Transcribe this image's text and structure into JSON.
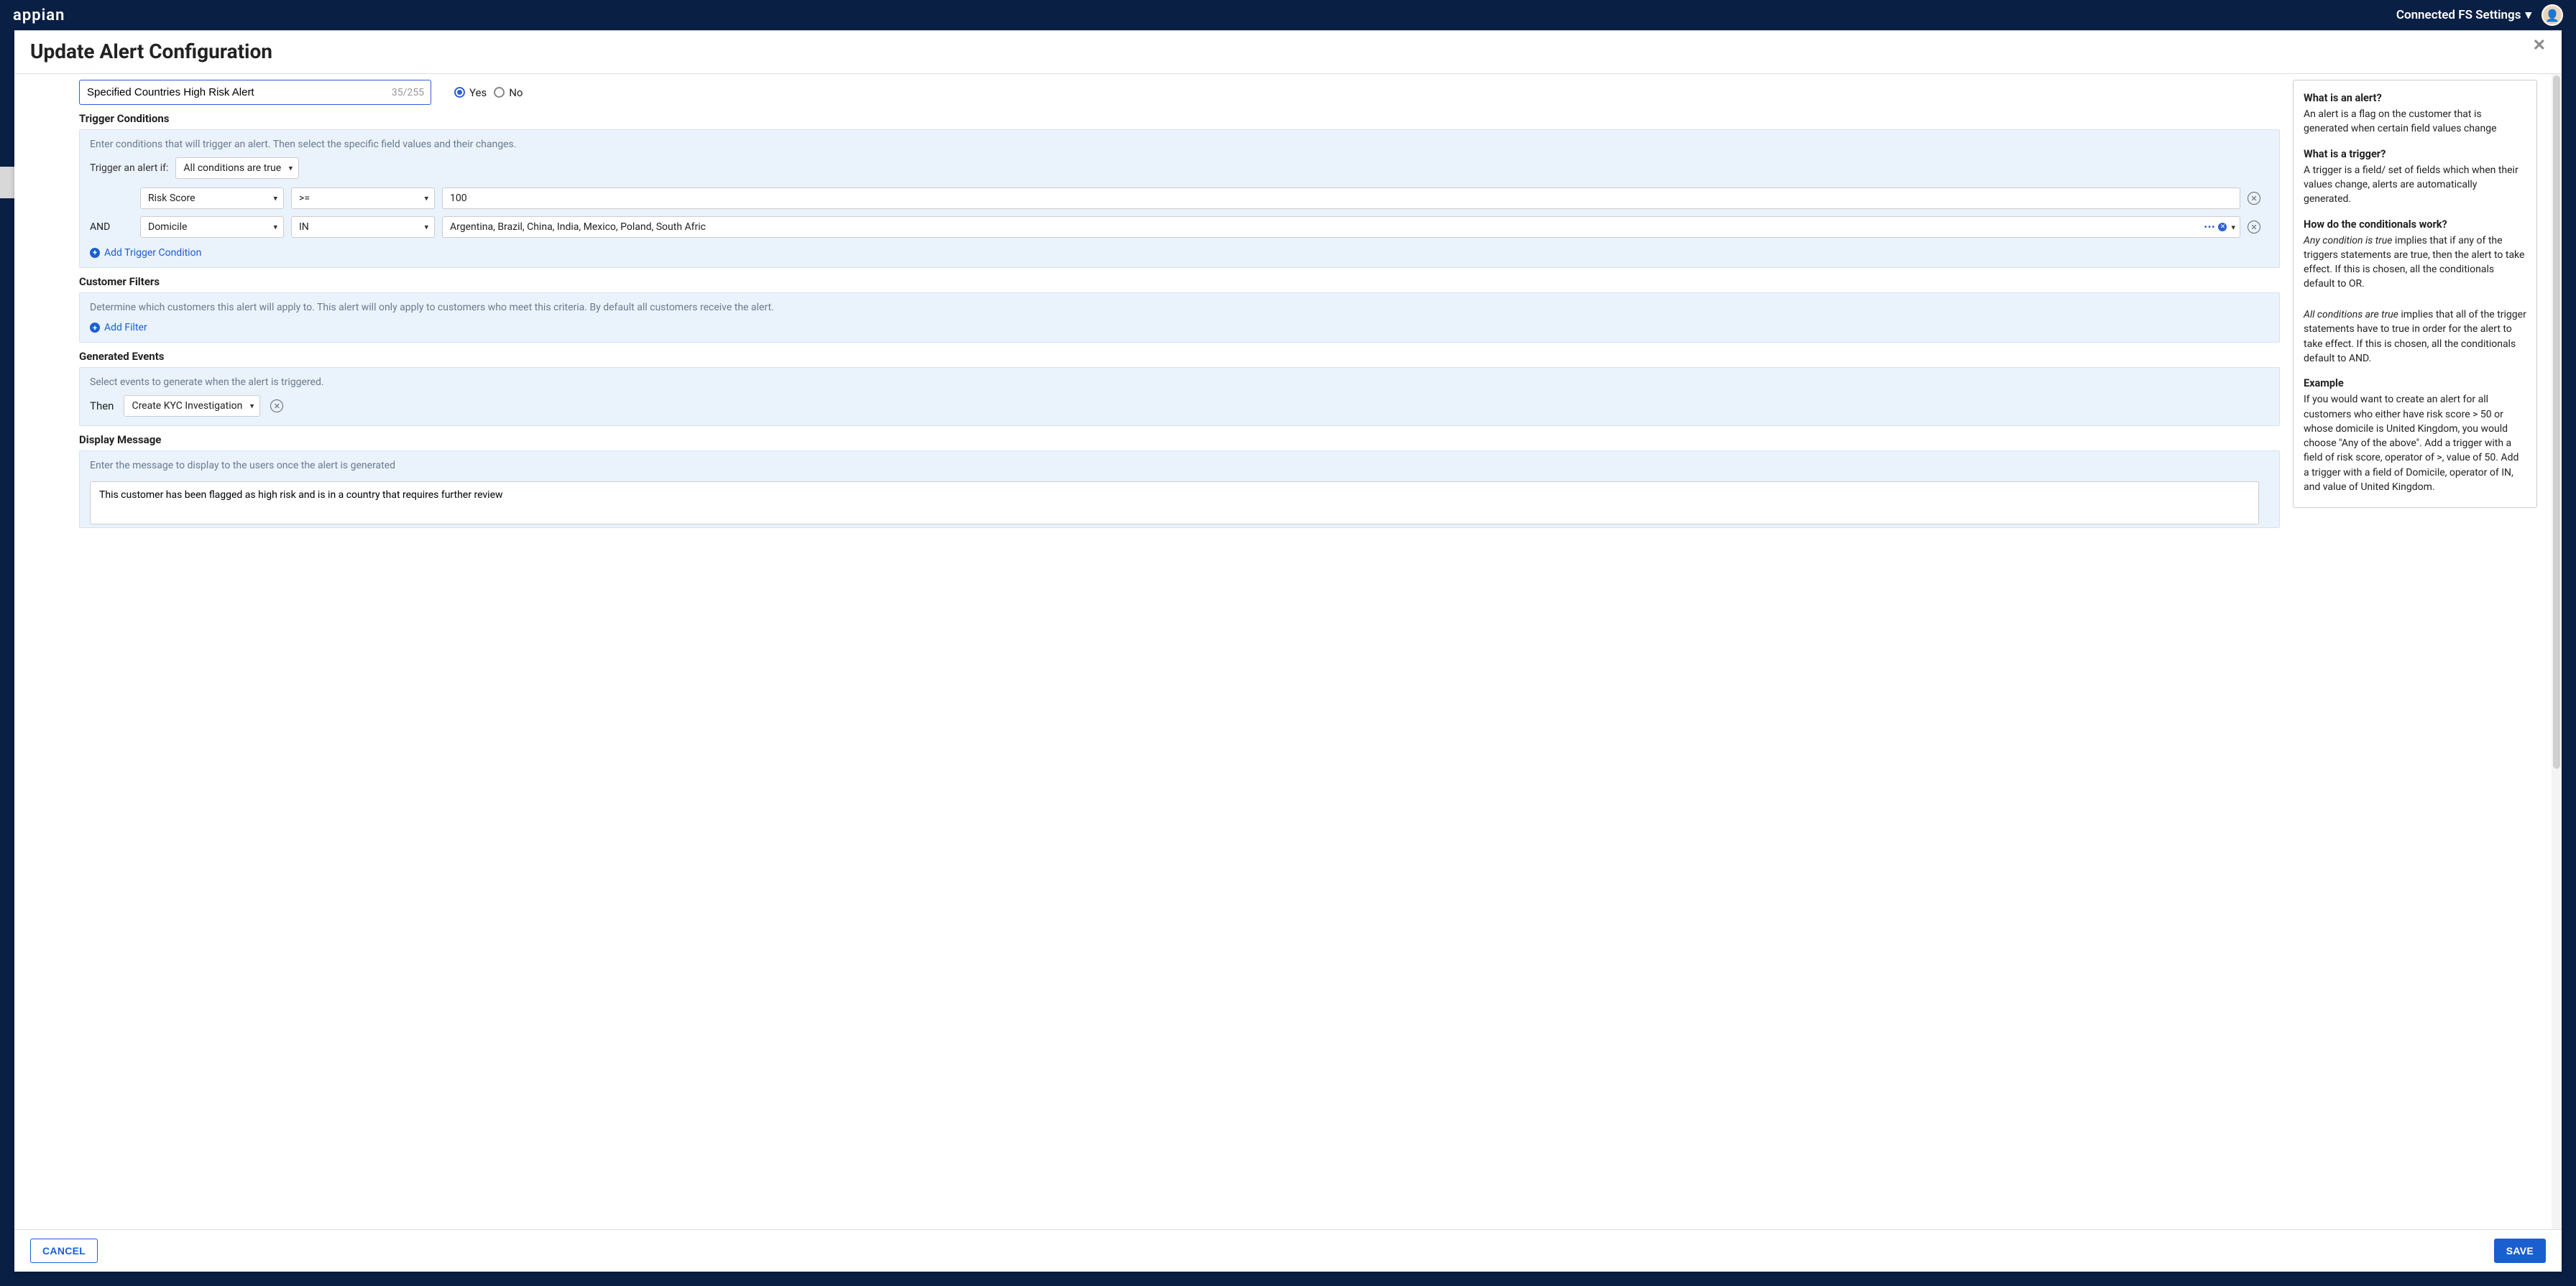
{
  "topbar": {
    "logo": "appian",
    "settings_label": "Connected FS Settings"
  },
  "modal": {
    "title": "Update Alert Configuration",
    "name_value": "Specified Countries High Risk Alert",
    "char_count": "35/255",
    "radio_yes": "Yes",
    "radio_no": "No",
    "sections": {
      "trigger_title": "Trigger Conditions",
      "trigger_hint": "Enter conditions that will trigger an alert. Then select the specific field values and their changes.",
      "trigger_if_label": "Trigger an alert if:",
      "trigger_mode": "All conditions are true",
      "conditions": [
        {
          "conjunction": "",
          "field": "Risk Score",
          "operator": ">=",
          "value": "100",
          "is_multi": false
        },
        {
          "conjunction": "AND",
          "field": "Domicile",
          "operator": "IN",
          "value": "Argentina, Brazil, China, India, Mexico, Poland, South Afric",
          "is_multi": true
        }
      ],
      "add_trigger": "Add Trigger Condition",
      "filters_title": "Customer Filters",
      "filters_hint": "Determine which customers this alert will apply to. This alert will only apply to customers who meet this criteria. By default all customers receive the alert.",
      "add_filter": "Add Filter",
      "events_title": "Generated Events",
      "events_hint": "Select events to generate when the alert is triggered.",
      "then_label": "Then",
      "event_action": "Create KYC Investigation",
      "message_title": "Display Message",
      "message_hint": "Enter the message to display to the users once the alert is generated",
      "message_value": "This customer has been flagged as high risk and is in a country that requires further review"
    },
    "help": {
      "h1": "What is an alert?",
      "p1": "An alert is a flag on the customer that is generated when certain field values change",
      "h2": "What is a trigger?",
      "p2": "A trigger is a field/ set of fields which when their values change, alerts are automatically generated.",
      "h3": "How do the conditionals work?",
      "p3a_em": "Any condition is true",
      "p3a": " implies that if any of the triggers statements are true, then the alert to take effect. If this is chosen, all the conditionals default to OR.",
      "p3b_em": "All conditions are true",
      "p3b": " implies that all of the trigger statements have to true in order for the alert to take effect. If this is chosen, all the conditionals default to AND.",
      "h4": "Example",
      "p4": "If you would want to create an alert for all customers who either have risk score > 50 or whose domicile is United Kingdom, you would choose \"Any of the above\". Add a trigger with a field of risk score, operator of >, value of 50. Add a trigger with a field of Domicile, operator of IN, and value of United Kingdom."
    },
    "buttons": {
      "cancel": "CANCEL",
      "save": "SAVE"
    }
  }
}
